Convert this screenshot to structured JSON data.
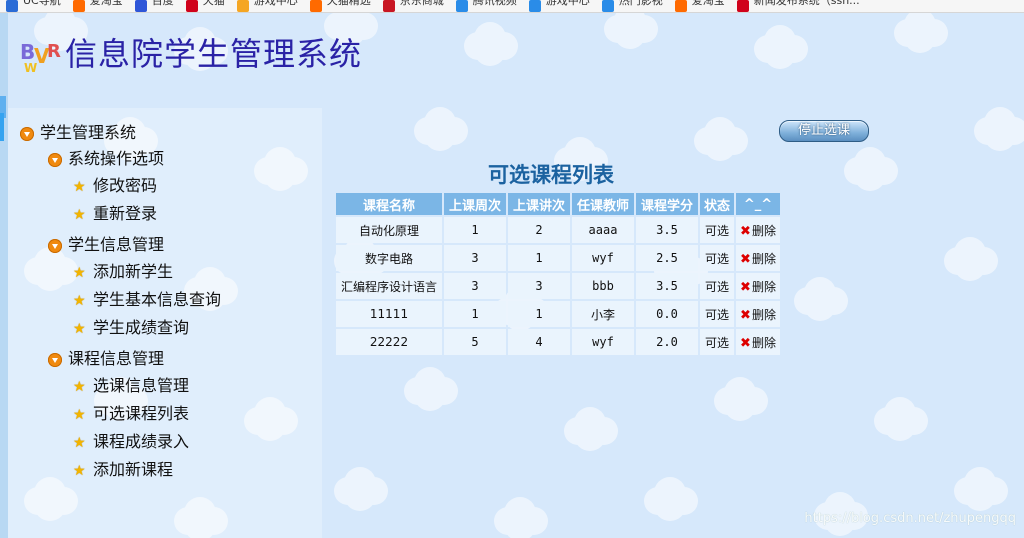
{
  "bookmarks": [
    {
      "label": "UC导航",
      "icon": "uc-nav-icon",
      "color": "#2b6cd6"
    },
    {
      "label": "爱淘宝",
      "icon": "aitaobao-icon",
      "color": "#ff6a00"
    },
    {
      "label": "百度",
      "icon": "baidu-icon",
      "color": "#2f56d8"
    },
    {
      "label": "天猫",
      "icon": "tmall-icon",
      "color": "#d0021b"
    },
    {
      "label": "游戏中心",
      "icon": "game-center-icon",
      "color": "#f5a623"
    },
    {
      "label": "天猫精选",
      "icon": "tmall-select-icon",
      "color": "#ff6a00"
    },
    {
      "label": "京东商城",
      "icon": "jd-icon",
      "color": "#c81623"
    },
    {
      "label": "腾讯视频",
      "icon": "tencent-video-icon",
      "color": "#2a8ce8"
    },
    {
      "label": "游戏中心",
      "icon": "game-center-icon",
      "color": "#2a8ce8"
    },
    {
      "label": "热门影视",
      "icon": "movie-icon",
      "color": "#2a8ce8"
    },
    {
      "label": "爱淘宝",
      "icon": "aitaobao-icon",
      "color": "#ff6a00"
    },
    {
      "label": "新闻发布系统（ssh...",
      "icon": "news-system-icon",
      "color": "#d0021b"
    }
  ],
  "header": {
    "title": "信息院学生管理系统",
    "logo_letters": "BVR"
  },
  "sidebar": {
    "root": "学生管理系统",
    "groups": [
      {
        "label": "系统操作选项",
        "items": [
          "修改密码",
          "重新登录"
        ]
      },
      {
        "label": "学生信息管理",
        "items": [
          "添加新学生",
          "学生基本信息查询",
          "学生成绩查询"
        ]
      },
      {
        "label": "课程信息管理",
        "items": [
          "选课信息管理",
          "可选课程列表",
          "课程成绩录入",
          "添加新课程"
        ]
      }
    ]
  },
  "stop_button": "停止选课",
  "course_list": {
    "title": "可选课程列表",
    "headers": [
      "课程名称",
      "上课周次",
      "上课讲次",
      "任课教师",
      "课程学分",
      "状态",
      "^_^"
    ],
    "rows": [
      {
        "name": "自动化原理",
        "week": "1",
        "session": "2",
        "teacher": "aaaa",
        "credit": "3.5",
        "status": "可选",
        "action": "删除"
      },
      {
        "name": "数字电路",
        "week": "3",
        "session": "1",
        "teacher": "wyf",
        "credit": "2.5",
        "status": "可选",
        "action": "删除"
      },
      {
        "name": "汇编程序设计语言",
        "week": "3",
        "session": "3",
        "teacher": "bbb",
        "credit": "3.5",
        "status": "可选",
        "action": "删除"
      },
      {
        "name": "11111",
        "week": "1",
        "session": "1",
        "teacher": "小李",
        "credit": "0.0",
        "status": "可选",
        "action": "删除"
      },
      {
        "name": "22222",
        "week": "5",
        "session": "4",
        "teacher": "wyf",
        "credit": "2.0",
        "status": "可选",
        "action": "删除"
      }
    ]
  },
  "watermark": "https://blog.csdn.net/zhupengqq"
}
